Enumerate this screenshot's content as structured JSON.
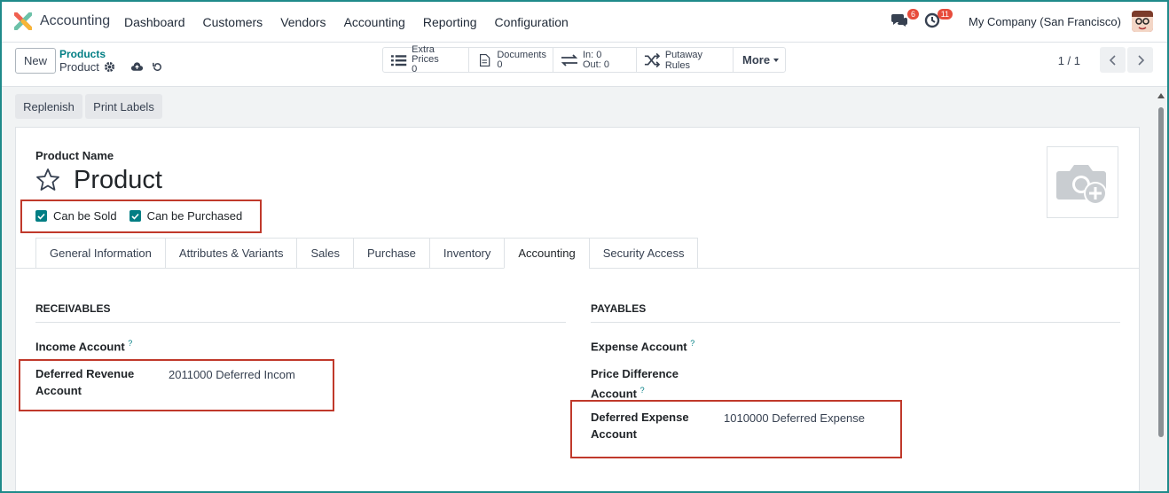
{
  "navbar": {
    "app_name": "Accounting",
    "menu": [
      "Dashboard",
      "Customers",
      "Vendors",
      "Accounting",
      "Reporting",
      "Configuration"
    ],
    "messages_count": "6",
    "activities_count": "11",
    "company": "My Company (San Francisco)"
  },
  "control": {
    "new_label": "New",
    "breadcrumb_parent": "Products",
    "breadcrumb_current": "Product",
    "smart_buttons": {
      "extra_prices_label": "Extra Prices",
      "extra_prices_value": "0",
      "documents_label": "Documents",
      "documents_value": "0",
      "in_label": "In: 0",
      "out_label": "Out: 0",
      "putaway_label": "Putaway Rules",
      "more_label": "More"
    },
    "pager": "1 / 1"
  },
  "actions": {
    "replenish": "Replenish",
    "print_labels": "Print Labels"
  },
  "form": {
    "product_name_label": "Product Name",
    "product_name": "Product",
    "can_be_sold": "Can be Sold",
    "can_be_purchased": "Can be Purchased",
    "tabs": [
      "General Information",
      "Attributes & Variants",
      "Sales",
      "Purchase",
      "Inventory",
      "Accounting",
      "Security Access"
    ],
    "active_tab": "Accounting",
    "receivables": {
      "heading": "RECEIVABLES",
      "income_account_label": "Income Account",
      "deferred_revenue_label_1": "Deferred Revenue",
      "deferred_revenue_label_2": "Account",
      "deferred_revenue_value": "2011000 Deferred Incom"
    },
    "payables": {
      "heading": "PAYABLES",
      "expense_account_label": "Expense Account",
      "price_difference_label_1": "Price Difference",
      "price_difference_label_2": "Account",
      "deferred_expense_label_1": "Deferred Expense",
      "deferred_expense_label_2": "Account",
      "deferred_expense_value": "1010000 Deferred Expense"
    },
    "help_mark": "?"
  },
  "colors": {
    "accent": "#017e84",
    "highlight": "#c0392b",
    "badge": "#e74c3c"
  }
}
